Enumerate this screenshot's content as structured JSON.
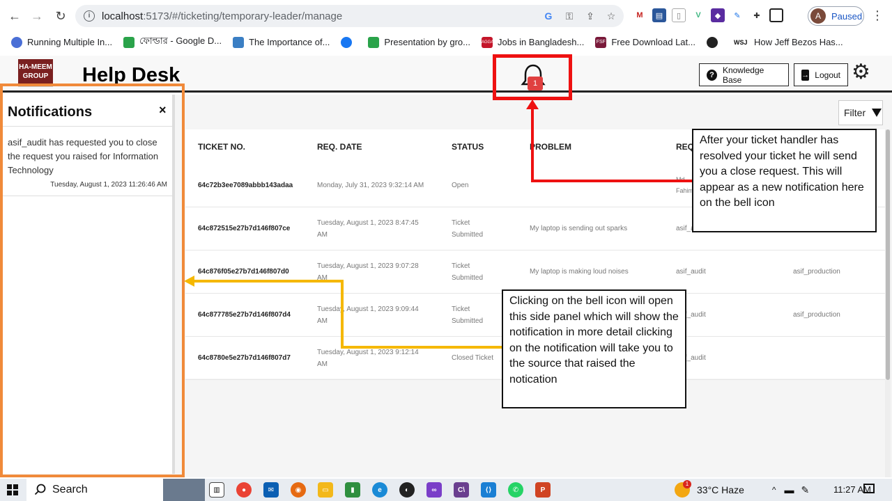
{
  "browser": {
    "url_host": "localhost",
    "url_path": ":5173/#/ticketing/temporary-leader/manage",
    "profile_initial": "A",
    "profile_status": "Paused",
    "bookmarks": [
      {
        "label": "Running Multiple In...",
        "color": "#4a6fd6"
      },
      {
        "label": "ফোল্ডার - Google D...",
        "color": "#2aa34a"
      },
      {
        "label": "The Importance of...",
        "color": "#3b7fc4"
      },
      {
        "label": "",
        "color": "#1877f2"
      },
      {
        "label": "Presentation by gro...",
        "color": "#2aa34a"
      },
      {
        "label": "Jobs in Bangladesh...",
        "color": "#c4162a"
      },
      {
        "label": "Free Download Lat...",
        "color": "#7a1a3a"
      },
      {
        "label": "",
        "color": "#222222"
      },
      {
        "label": "How Jeff Bezos Has...",
        "color": "#ffffff"
      }
    ],
    "bookmark_badges": [
      "",
      "",
      "",
      "",
      "",
      "AGGA",
      "FSF",
      "",
      "WSJ"
    ]
  },
  "app": {
    "logo_line1": "HA-MEEM",
    "logo_line2": "GROUP",
    "title": "Help Desk",
    "bell_count": "1",
    "knowledge_base_label": "Knowledge Base",
    "logout_label": "Logout",
    "filter_label": "Filter"
  },
  "table": {
    "headers": [
      "TICKET NO.",
      "REQ. DATE",
      "STATUS",
      "PROBLEM",
      "REQ"
    ],
    "rows": [
      {
        "id": "64c72b3ee7089abbb143adaa",
        "date": "Monday, July 31, 2023 9:32:14 AM",
        "status": "Open",
        "problem": "",
        "req": "Md. Fahim",
        "handler": ""
      },
      {
        "id": "64c872515e27b7d146f807ce",
        "date": "Tuesday, August 1, 2023 8:47:45 AM",
        "status": "Ticket Submitted",
        "problem": "My laptop is sending out sparks",
        "req": "asif_a",
        "handler": ""
      },
      {
        "id": "64c876f05e27b7d146f807d0",
        "date": "Tuesday, August 1, 2023 9:07:28 AM",
        "status": "Ticket Submitted",
        "problem": "My laptop is making loud noises",
        "req": "asif_audit",
        "handler": "asif_production"
      },
      {
        "id": "64c877785e27b7d146f807d4",
        "date": "Tuesday, August 1, 2023 9:09:44 AM",
        "status": "Ticket Submitted",
        "problem": "",
        "req": "asif_audit",
        "handler": "asif_production"
      },
      {
        "id": "64c8780e5e27b7d146f807d7",
        "date": "Tuesday, August 1, 2023 9:12:14 AM",
        "status": "Closed Ticket",
        "problem": "",
        "req": "asif_audit",
        "handler": ""
      }
    ]
  },
  "notifications": {
    "title": "Notifications",
    "close": "×",
    "items": [
      {
        "message": "asif_audit has requested you to close the request you raised for Information Technology",
        "time": "Tuesday, August 1, 2023 11:26:46 AM"
      }
    ]
  },
  "annotations": {
    "bell_callout": "After your ticket handler has resolved your ticket he will send you a close request. This will appear as a new notification here on the bell icon",
    "panel_callout": "Clicking on the bell icon will open this side panel which will show the notification in more detail clicking on the notification will take you to the source that raised the notication",
    "colors": {
      "red": "#ee1111",
      "orange": "#f08a3a",
      "yellow": "#f5b800"
    }
  },
  "taskbar": {
    "search_label": "Search",
    "weather": "33°C  Haze",
    "time": "11:27 AM",
    "weather_badge": "1"
  }
}
